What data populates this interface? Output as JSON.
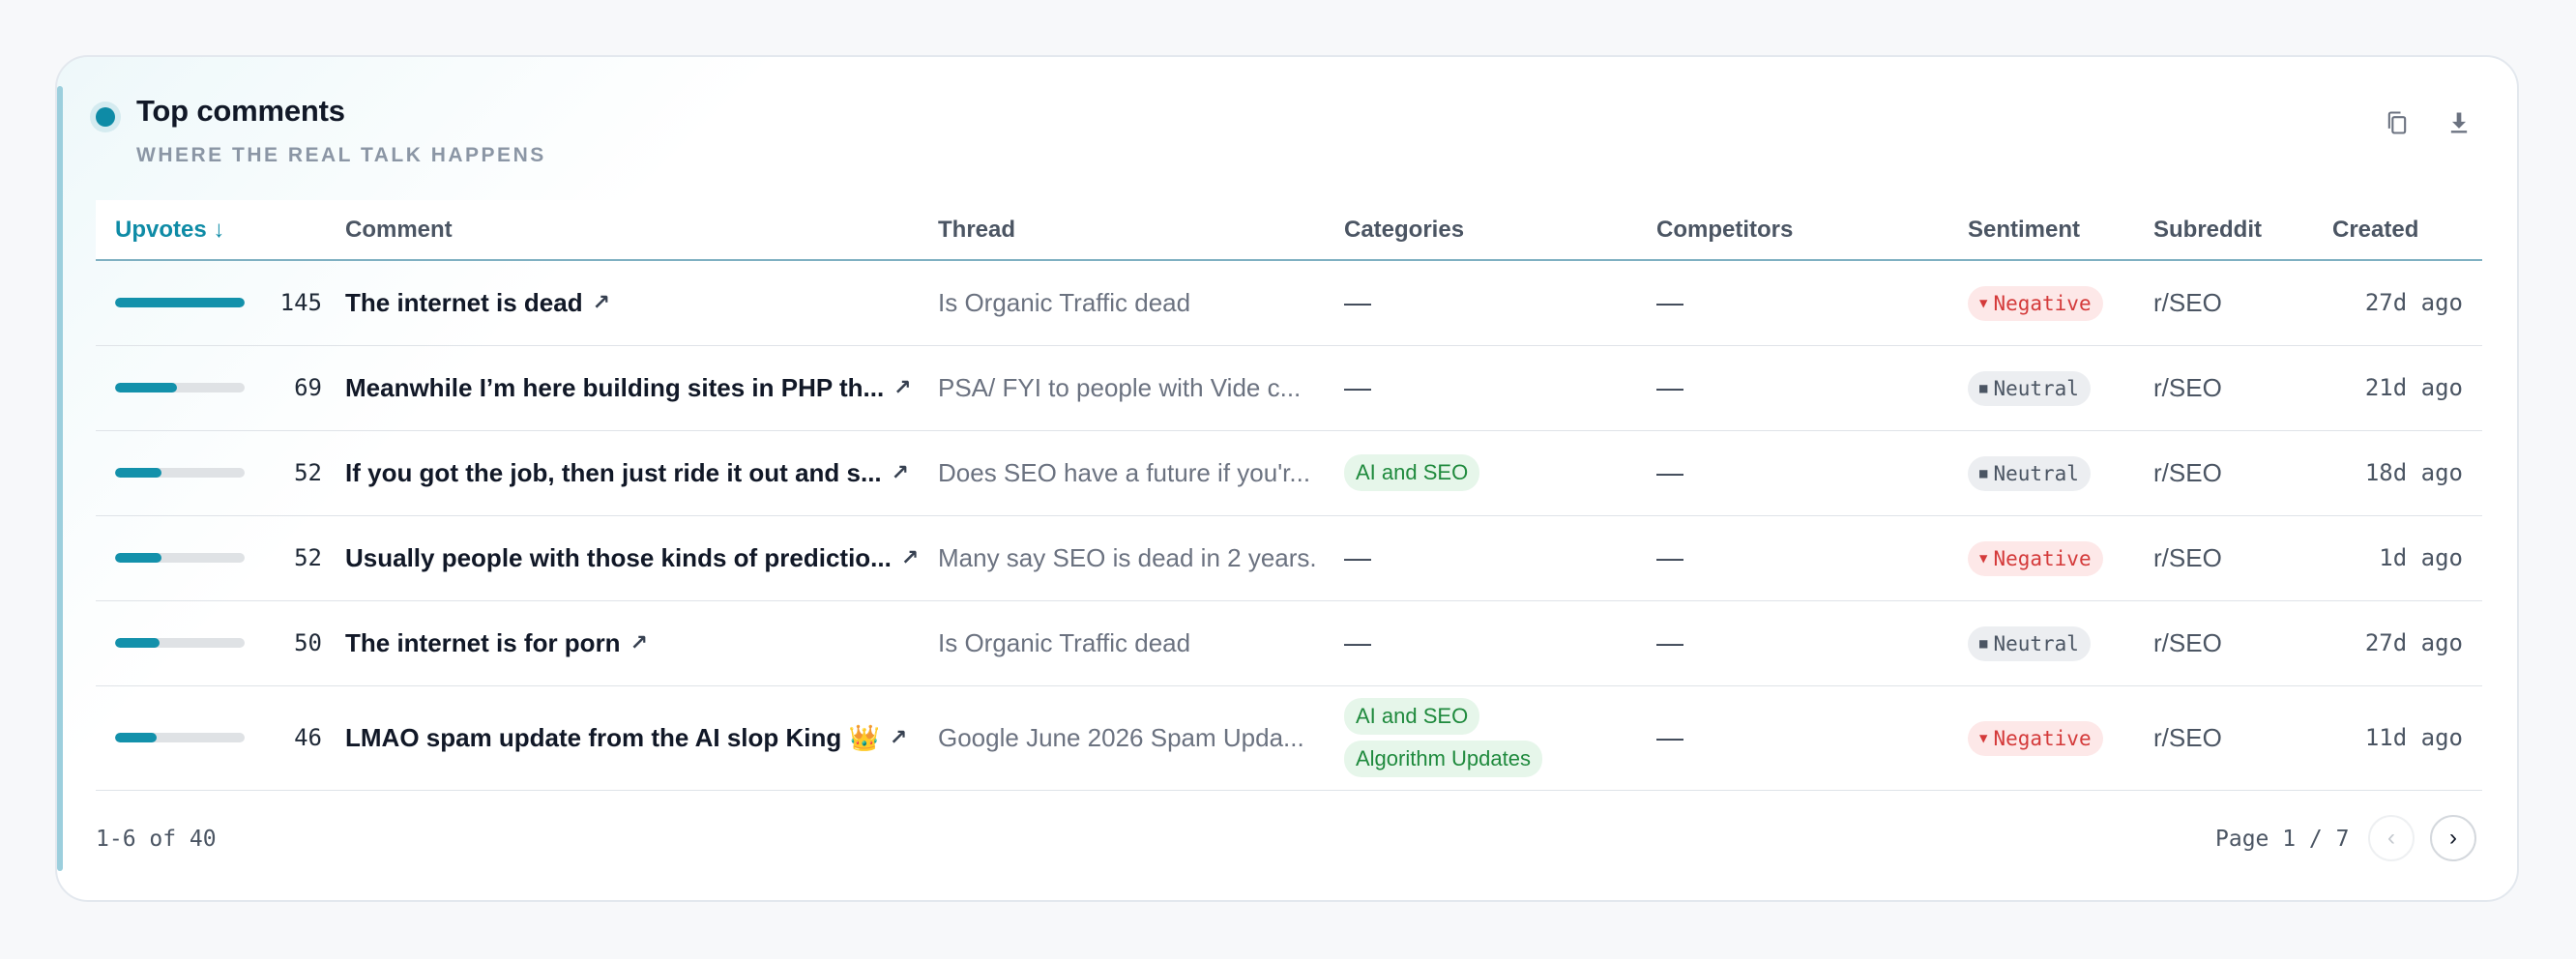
{
  "header": {
    "title": "Top comments",
    "subtitle": "WHERE THE REAL TALK HAPPENS",
    "icons": [
      "copy-icon",
      "download-icon"
    ]
  },
  "columns": {
    "upvotes": "Upvotes ↓",
    "comment": "Comment",
    "thread": "Thread",
    "categories": "Categories",
    "competitors": "Competitors",
    "sentiment": "Sentiment",
    "subreddit": "Subreddit",
    "created": "Created"
  },
  "rows": [
    {
      "upvotes": "145",
      "bar_fraction": 1.0,
      "comment": "The internet is dead",
      "thread": "Is Organic Traffic dead",
      "categories": [],
      "competitors": "—",
      "sentiment": "Negative",
      "subreddit": "r/SEO",
      "created": "27d ago",
      "categories_empty": "—"
    },
    {
      "upvotes": "69",
      "bar_fraction": 0.48,
      "comment": "Meanwhile I’m here building sites in PHP th...",
      "thread": "PSA/ FYI to people with Vide c...",
      "categories": [],
      "competitors": "—",
      "sentiment": "Neutral",
      "subreddit": "r/SEO",
      "created": "21d ago",
      "categories_empty": "—"
    },
    {
      "upvotes": "52",
      "bar_fraction": 0.36,
      "comment": "If you got the job, then just ride it out and s...",
      "thread": "Does SEO have a future if you'r...",
      "categories": [
        "AI and SEO"
      ],
      "competitors": "—",
      "sentiment": "Neutral",
      "subreddit": "r/SEO",
      "created": "18d ago",
      "categories_empty": ""
    },
    {
      "upvotes": "52",
      "bar_fraction": 0.36,
      "comment": "Usually people with those kinds of predictio...",
      "thread": "Many say SEO is dead in 2 years.",
      "categories": [],
      "competitors": "—",
      "sentiment": "Negative",
      "subreddit": "r/SEO",
      "created": "1d ago",
      "categories_empty": "—"
    },
    {
      "upvotes": "50",
      "bar_fraction": 0.34,
      "comment": "The internet is for porn",
      "thread": "Is Organic Traffic dead",
      "categories": [],
      "competitors": "—",
      "sentiment": "Neutral",
      "subreddit": "r/SEO",
      "created": "27d ago",
      "categories_empty": "—"
    },
    {
      "upvotes": "46",
      "bar_fraction": 0.32,
      "comment": "LMAO spam update from the AI slop King 👑",
      "thread": "Google June 2026 Spam Upda...",
      "categories": [
        "AI and SEO",
        "Algorithm Updates"
      ],
      "competitors": "—",
      "sentiment": "Negative",
      "subreddit": "r/SEO",
      "created": "11d ago",
      "categories_empty": ""
    }
  ],
  "footer": {
    "count": "1-6 of 40",
    "page": "Page 1 / 7",
    "prev": "‹",
    "next": "›"
  },
  "colors": {
    "accent": "#0e8ba6",
    "negative": "#d43a3a",
    "chip_green": "#1f8a3d"
  }
}
